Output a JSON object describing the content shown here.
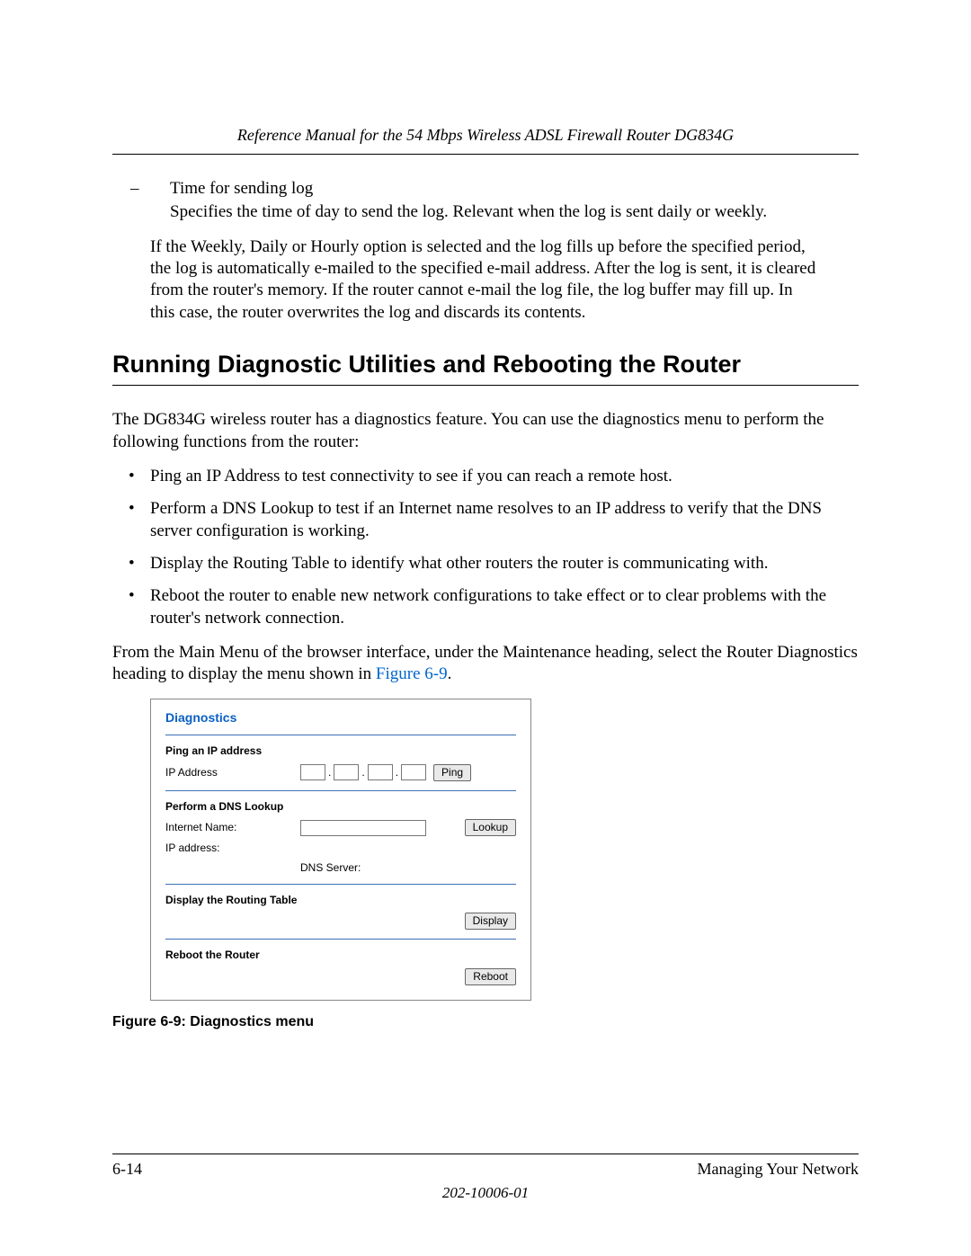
{
  "header": {
    "running_title": "Reference Manual for the 54 Mbps Wireless ADSL Firewall Router DG834G"
  },
  "body": {
    "sub_bullet_title": "Time for sending log",
    "sub_bullet_desc": "Specifies the time of day to send the log. Relevant when the log is sent daily or weekly.",
    "para_fill": "If the Weekly, Daily or Hourly option is selected and the log fills up before the specified period, the log is automatically e-mailed to the specified e-mail address. After the log is sent, it is cleared from the router's memory. If the router cannot e-mail the log file, the log buffer may fill up. In this case, the router overwrites the log and discards its contents.",
    "section_title": "Running Diagnostic Utilities and Rebooting the Router",
    "para_intro": "The DG834G wireless router has a diagnostics feature. You can use the diagnostics menu to perform the following functions from the router:",
    "bullets": [
      "Ping an IP Address to test connectivity to see if you can reach a remote host.",
      "Perform a DNS Lookup to test if an Internet name resolves to an IP address to verify that the DNS server configuration is working.",
      "Display the Routing Table to identify what other routers the router is communicating with.",
      "Reboot the router to enable new network configurations to take effect or to clear problems with the router's network connection."
    ],
    "para_menu_pre": "From the Main Menu of the browser interface, under the Maintenance heading, select the Router Diagnostics heading to display the menu shown in ",
    "figure_link": "Figure 6-9",
    "para_menu_post": "."
  },
  "diag": {
    "title": "Diagnostics",
    "ping_heading": "Ping an IP address",
    "ip_label": "IP Address",
    "ping_btn": "Ping",
    "dns_heading": "Perform a DNS Lookup",
    "internet_name_label": "Internet Name:",
    "lookup_btn": "Lookup",
    "ip_address_label": "IP address:",
    "dns_server_label": "DNS Server:",
    "routing_heading": "Display the Routing Table",
    "display_btn": "Display",
    "reboot_heading": "Reboot the Router",
    "reboot_btn": "Reboot"
  },
  "figure_caption": "Figure 6-9:  Diagnostics menu",
  "footer": {
    "page_number": "6-14",
    "section_name": "Managing Your Network",
    "doc_number": "202-10006-01"
  }
}
